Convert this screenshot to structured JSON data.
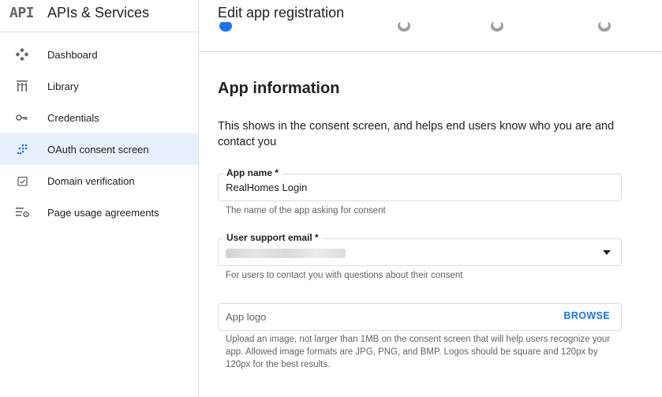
{
  "sidebar": {
    "logo_text": "API",
    "title": "APIs & Services",
    "items": [
      {
        "label": "Dashboard",
        "icon": "dashboard-icon"
      },
      {
        "label": "Library",
        "icon": "library-icon"
      },
      {
        "label": "Credentials",
        "icon": "key-icon"
      },
      {
        "label": "OAuth consent screen",
        "icon": "oauth-icon",
        "active": true
      },
      {
        "label": "Domain verification",
        "icon": "domain-check-icon"
      },
      {
        "label": "Page usage agreements",
        "icon": "settings-list-icon"
      }
    ]
  },
  "header": {
    "title": "Edit app registration"
  },
  "section": {
    "title": "App information",
    "description": "This shows in the consent screen, and helps end users know who you are and contact you"
  },
  "form": {
    "app_name": {
      "label": "App name *",
      "value": "RealHomes Login",
      "helper": "The name of the app asking for consent"
    },
    "support_email": {
      "label": "User support email *",
      "helper": "For users to contact you with questions about their consent"
    },
    "app_logo": {
      "placeholder": "App logo",
      "browse_label": "BROWSE",
      "helper": "Upload an image, not larger than 1MB on the consent screen that will help users recognize your app. Allowed image formats are JPG, PNG, and BMP. Logos should be square and 120px by 120px for the best results."
    }
  },
  "colors": {
    "accent": "#1a73e8",
    "active_bg": "#e8f0fe",
    "border": "#dadce0",
    "muted_text": "#5f6368"
  }
}
